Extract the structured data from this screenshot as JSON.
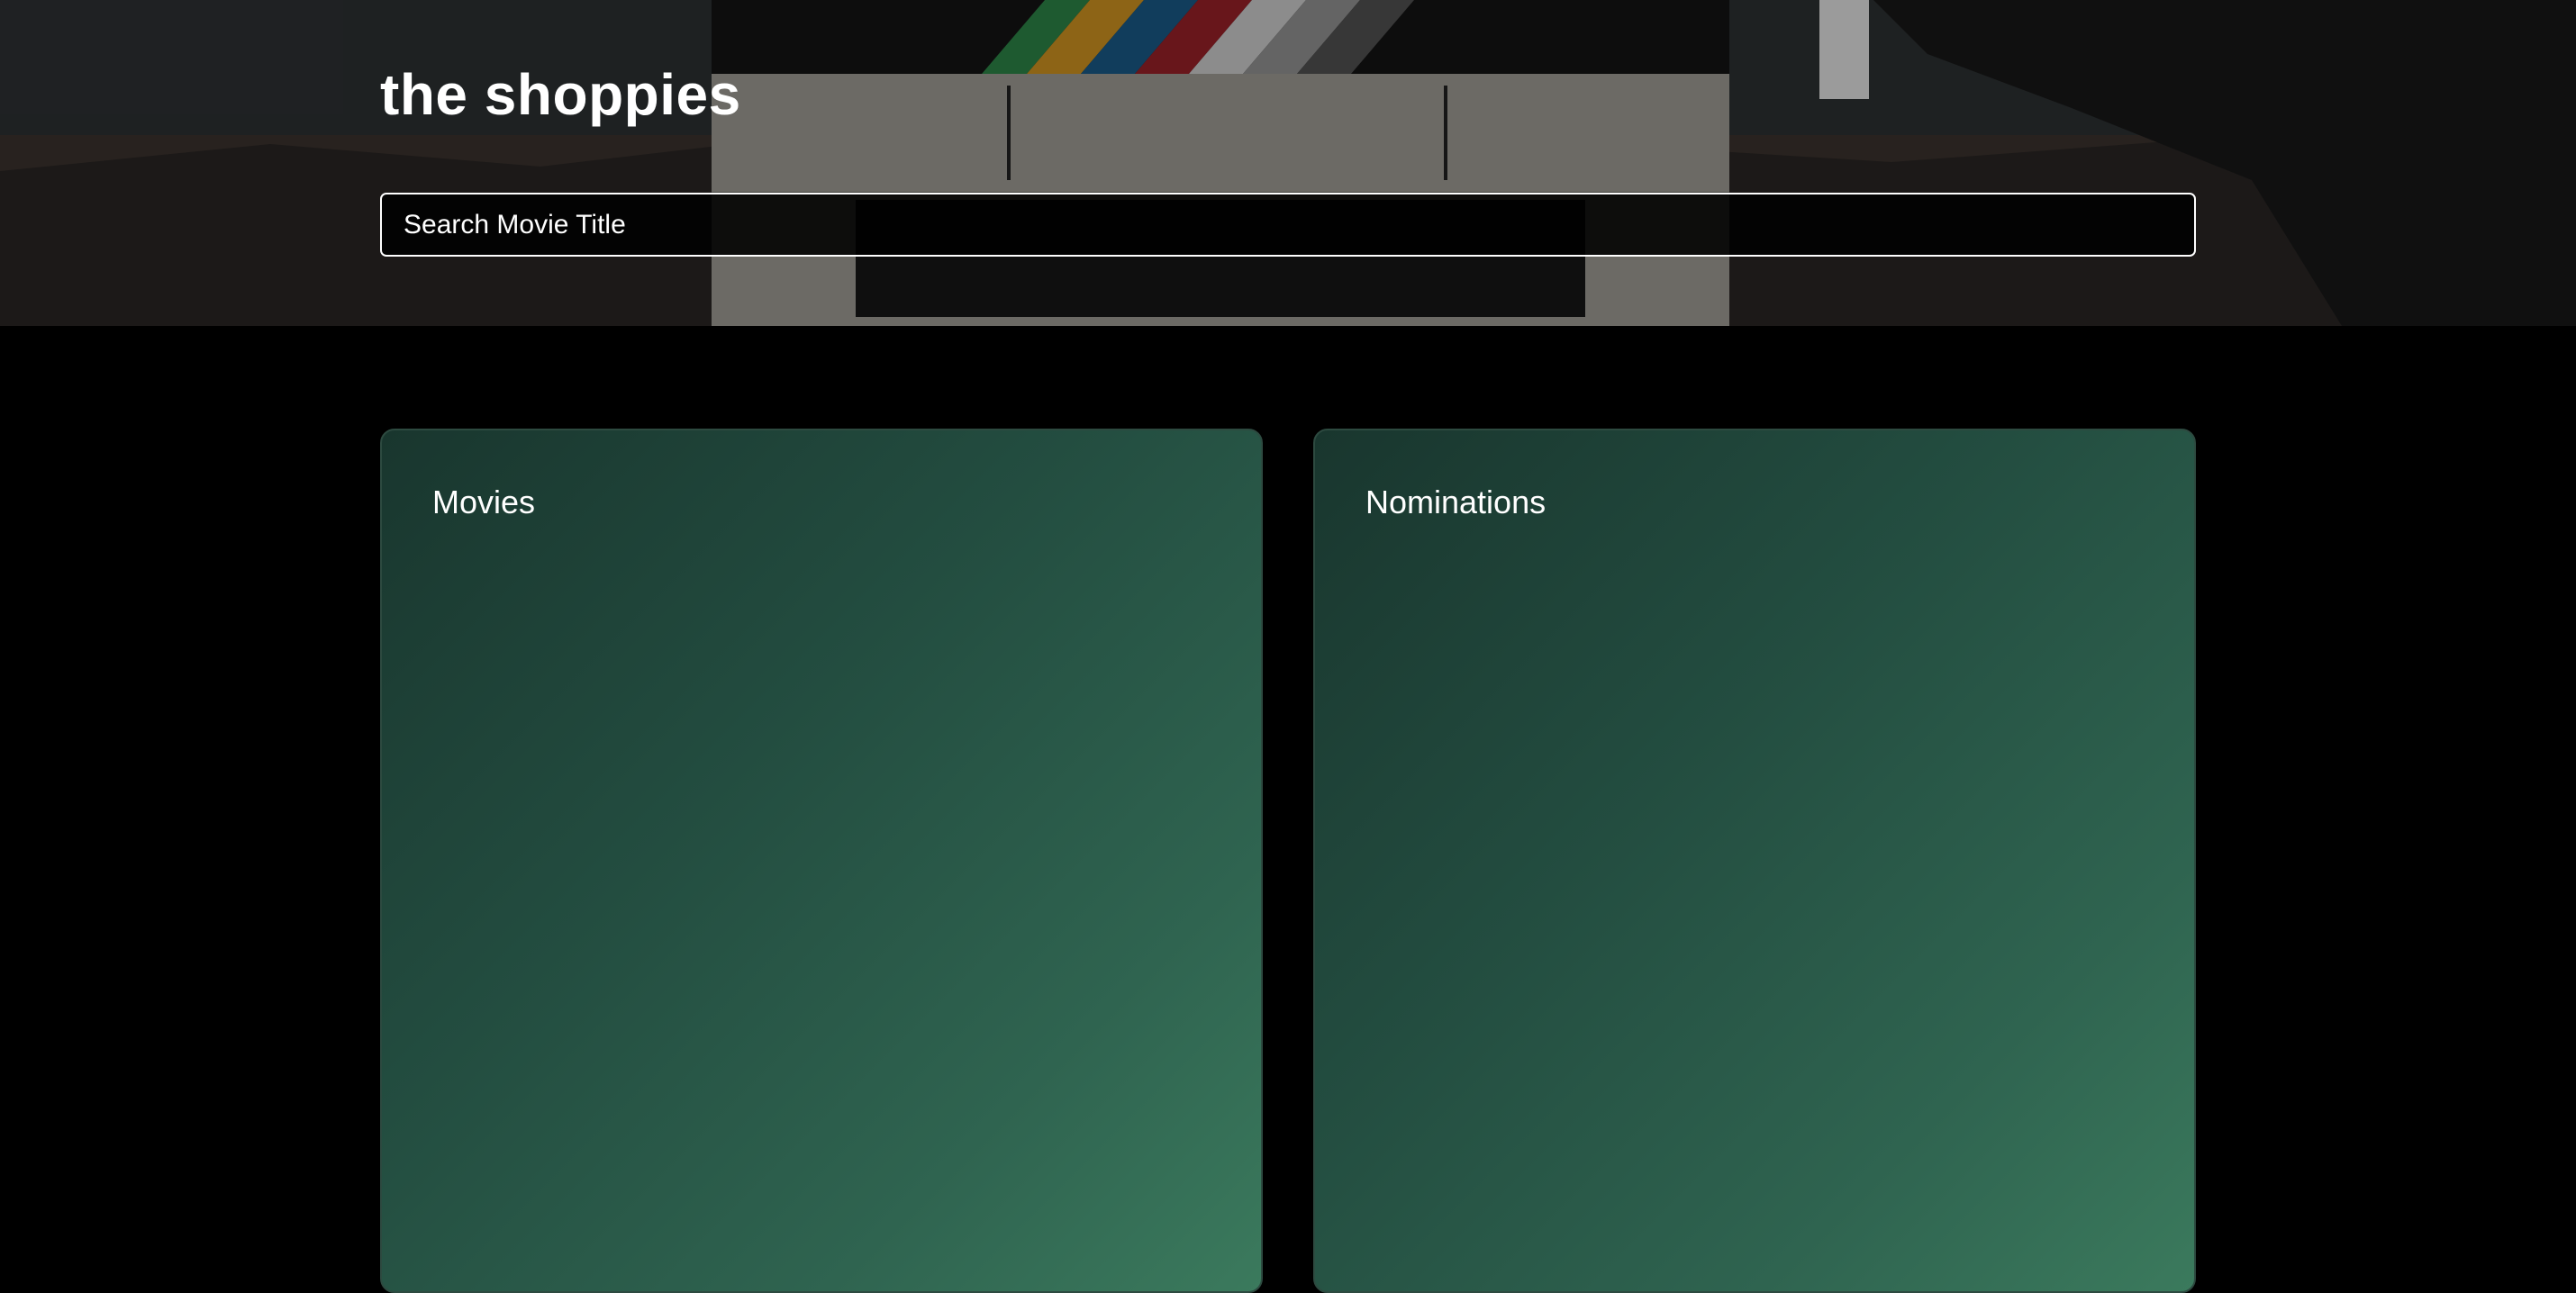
{
  "header": {
    "title": "the shoppies"
  },
  "search": {
    "placeholder": "Search Movie Title",
    "value": ""
  },
  "panels": {
    "movies": {
      "title": "Movies"
    },
    "nominations": {
      "title": "Nominations"
    }
  },
  "colors": {
    "background": "#000000",
    "panel_gradient_start": "#19362e",
    "panel_gradient_end": "#3b7a5d",
    "text": "#ffffff"
  },
  "icons": {
    "hero_background": "film-clapperboard-photo"
  }
}
